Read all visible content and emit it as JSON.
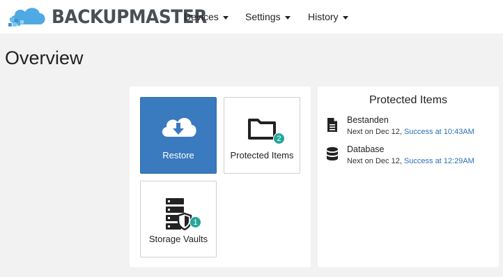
{
  "app": {
    "name": "BACKUPMASTER"
  },
  "nav": [
    {
      "label": "Devices"
    },
    {
      "label": "Settings"
    },
    {
      "label": "History"
    }
  ],
  "page": {
    "title": "Overview"
  },
  "tiles": {
    "restore": {
      "label": "Restore"
    },
    "protected_items": {
      "label": "Protected Items",
      "badge": "2"
    },
    "storage_vaults": {
      "label": "Storage Vaults",
      "badge": "1"
    }
  },
  "protected_panel": {
    "title": "Protected Items",
    "items": [
      {
        "name": "Bestanden",
        "icon": "file-icon",
        "next": "Next on Dec 12,",
        "status": "Success at 10:43AM"
      },
      {
        "name": "Database",
        "icon": "database-icon",
        "next": "Next on Dec 12,",
        "status": "Success at 12:29AM"
      }
    ]
  },
  "colors": {
    "primary": "#3a7abf",
    "badge": "#26a69a",
    "link": "#2a6fb8",
    "logo_cloud": "#4fa9e2",
    "logo_text": "#4a4f55"
  }
}
